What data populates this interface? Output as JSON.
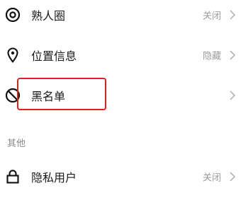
{
  "privacy_rows": [
    {
      "label": "熟人圈",
      "value": "关闭",
      "icon": "circle-target-icon"
    },
    {
      "label": "位置信息",
      "value": "隐藏",
      "icon": "location-pin-icon"
    },
    {
      "label": "黑名单",
      "value": "",
      "icon": "block-icon"
    }
  ],
  "section_other": {
    "title": "其他"
  },
  "other_rows": [
    {
      "label": "隐私用户",
      "value": "关闭",
      "icon": "lock-icon"
    }
  ],
  "colors": {
    "highlight": "#e02020",
    "text": "#1a1a1a",
    "value_text": "#9a9a9a",
    "chevron": "#b5b5b5"
  }
}
